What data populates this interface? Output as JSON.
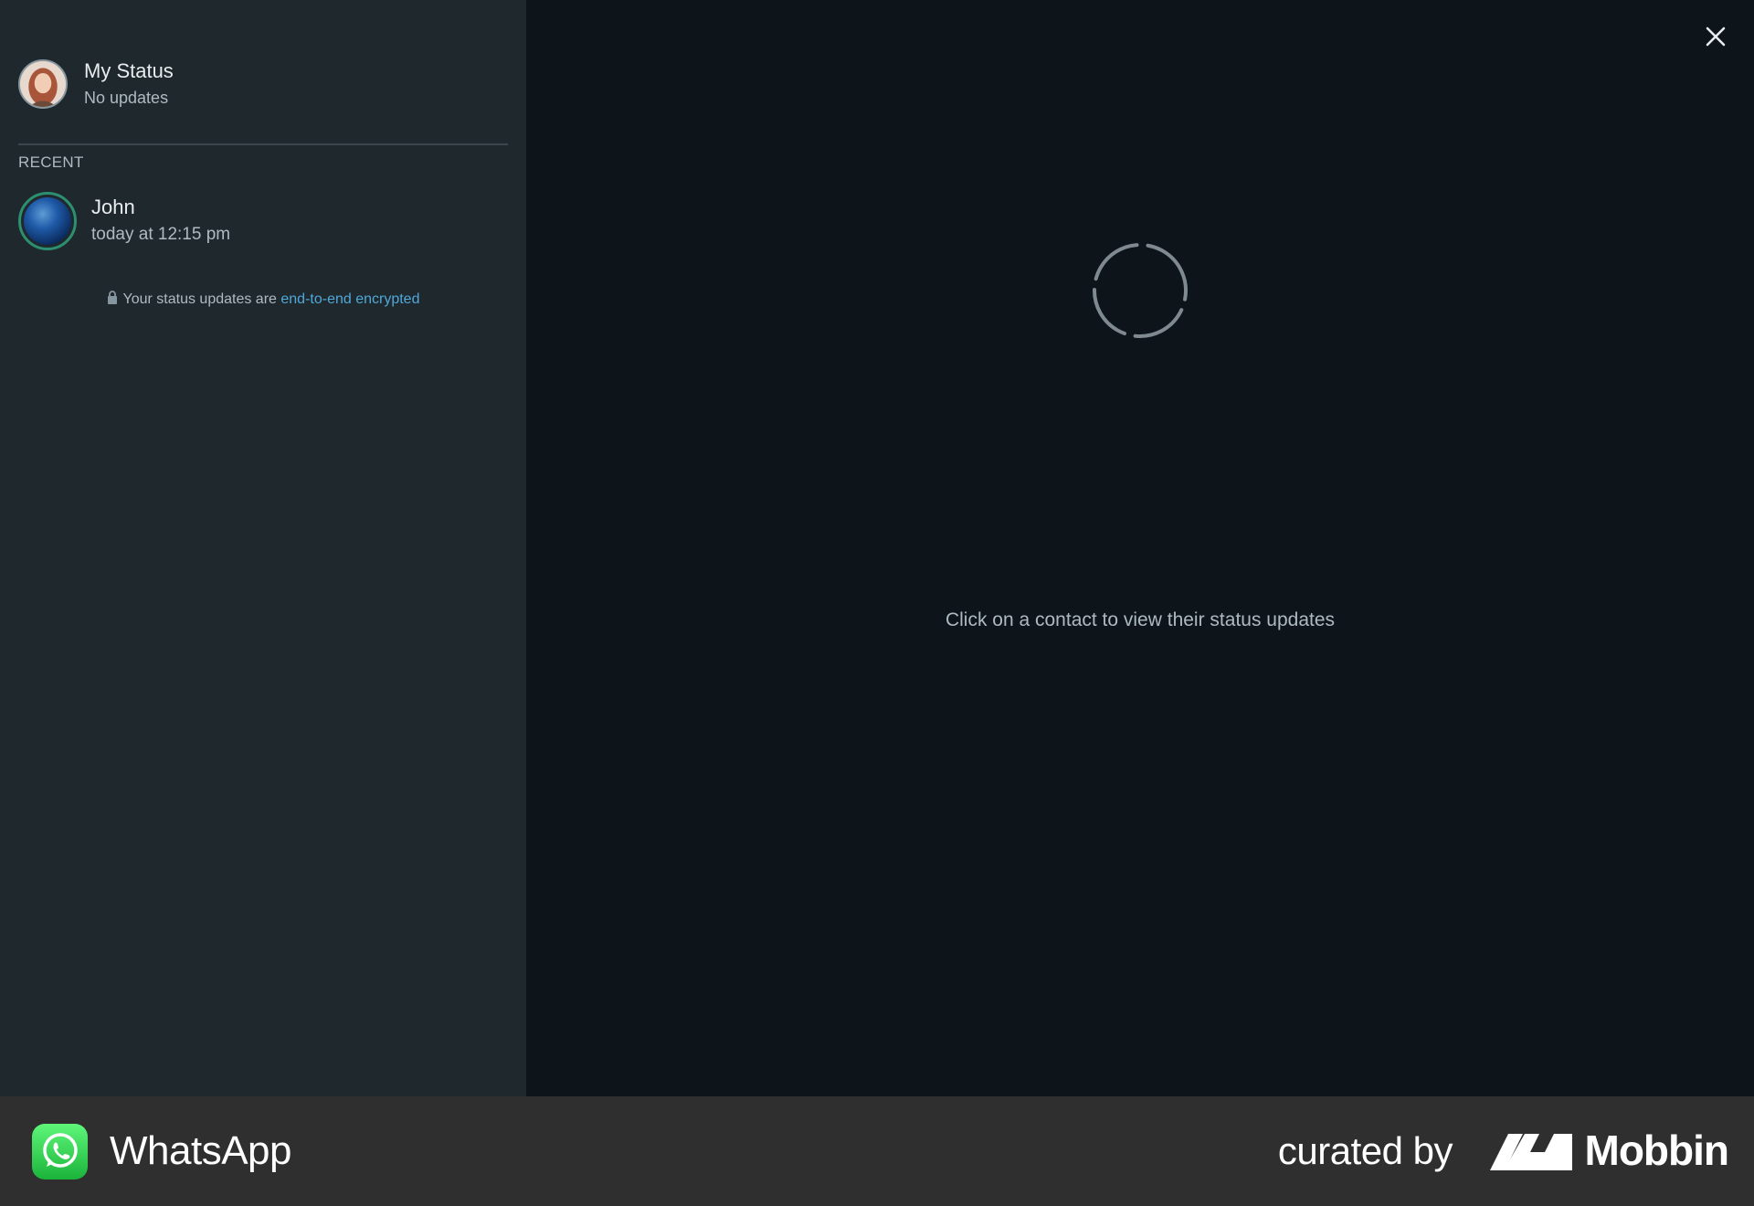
{
  "sidebar": {
    "my_status": {
      "name": "My Status",
      "subtitle": "No updates"
    },
    "section_label": "RECENT",
    "recent": [
      {
        "name": "John",
        "time": "today at 12:15 pm"
      }
    ],
    "encryption_note": {
      "text": "Your status updates are ",
      "link": "end-to-end encrypted"
    }
  },
  "main": {
    "hint": "Click on a contact to view their status updates",
    "close_icon": "close-icon",
    "loading_icon": "spinner-icon"
  },
  "footer": {
    "app_name": "WhatsApp",
    "curated_label": "curated by",
    "curator": "Mobbin"
  },
  "colors": {
    "sidebar_bg": "#1f282d",
    "main_bg": "#0d141a",
    "footer_bg": "#2f2f2f",
    "link": "#4fa8d9",
    "status_ring": "#2c8f6f",
    "whatsapp_green": "#25d366"
  }
}
